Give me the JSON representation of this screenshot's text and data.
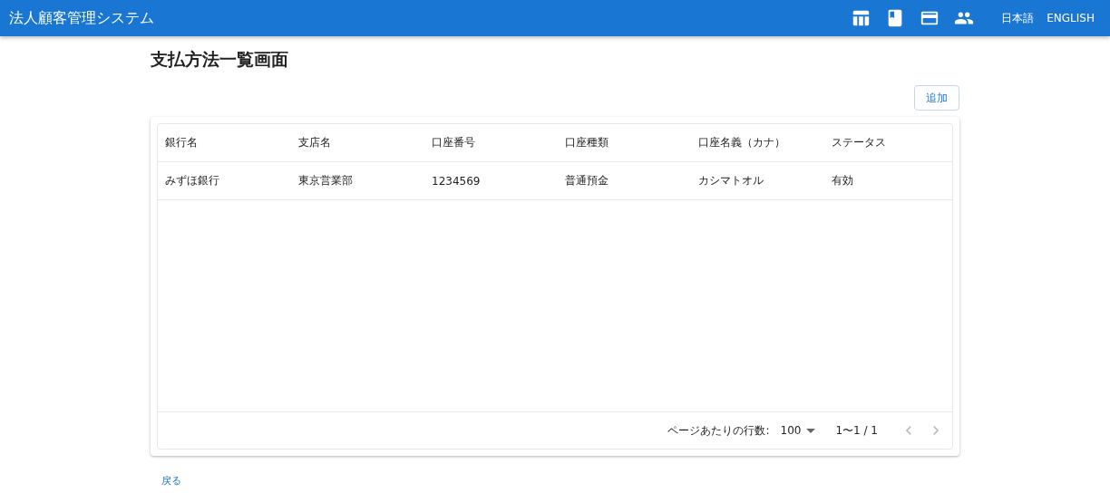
{
  "app_bar": {
    "title": "法人顧客管理システム",
    "languages": [
      "日本語",
      "ENGLISH"
    ]
  },
  "page": {
    "title": "支払方法一覧画面",
    "add_button": "追加"
  },
  "table": {
    "columns": [
      "銀行名",
      "支店名",
      "口座番号",
      "口座種類",
      "口座名義（カナ）",
      "ステータス"
    ],
    "rows": [
      [
        "みずほ銀行",
        "東京営業部",
        "1234569",
        "普通預金",
        "カシマトオル",
        "有効"
      ]
    ]
  },
  "pagination": {
    "rows_per_page_label": "ページあたりの行数:",
    "rows_per_page": "100",
    "range": "1〜1 / 1",
    "prev_disabled": true,
    "next_disabled": true
  },
  "back_link": "戻る"
}
